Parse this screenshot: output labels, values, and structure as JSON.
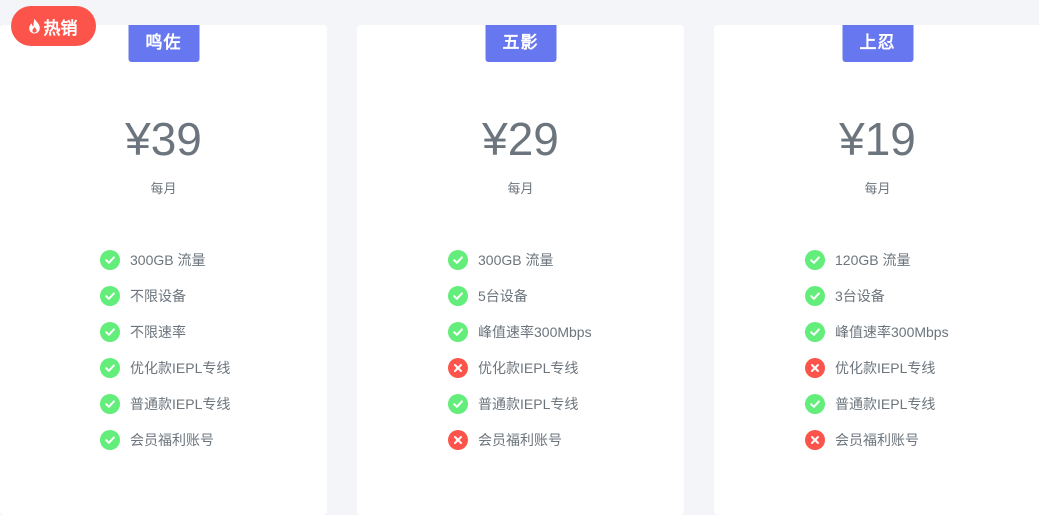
{
  "badge": {
    "label": "热销",
    "icon": "fire-icon",
    "color": "#fc544b"
  },
  "colors": {
    "accent": "#6777ef",
    "check": "#63ed7a",
    "cross": "#fc544b"
  },
  "plans": [
    {
      "name": "鸣佐",
      "price": "¥39",
      "period": "每月",
      "features": [
        {
          "text": "300GB 流量",
          "included": true
        },
        {
          "text": "不限设备",
          "included": true
        },
        {
          "text": "不限速率",
          "included": true
        },
        {
          "text": "优化款IEPL专线",
          "included": true
        },
        {
          "text": "普通款IEPL专线",
          "included": true
        },
        {
          "text": "会员福利账号",
          "included": true
        }
      ]
    },
    {
      "name": "五影",
      "price": "¥29",
      "period": "每月",
      "features": [
        {
          "text": "300GB 流量",
          "included": true
        },
        {
          "text": "5台设备",
          "included": true
        },
        {
          "text": "峰值速率300Mbps",
          "included": true
        },
        {
          "text": "优化款IEPL专线",
          "included": false
        },
        {
          "text": "普通款IEPL专线",
          "included": true
        },
        {
          "text": "会员福利账号",
          "included": false
        }
      ]
    },
    {
      "name": "上忍",
      "price": "¥19",
      "period": "每月",
      "features": [
        {
          "text": "120GB 流量",
          "included": true
        },
        {
          "text": "3台设备",
          "included": true
        },
        {
          "text": "峰值速率300Mbps",
          "included": true
        },
        {
          "text": "优化款IEPL专线",
          "included": false
        },
        {
          "text": "普通款IEPL专线",
          "included": true
        },
        {
          "text": "会员福利账号",
          "included": false
        }
      ]
    }
  ]
}
